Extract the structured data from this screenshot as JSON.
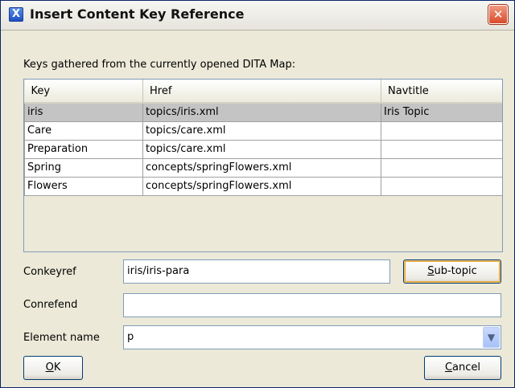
{
  "window": {
    "title": "Insert Content Key Reference",
    "close_glyph": "✕",
    "app_icon_glyph": "X"
  },
  "keys_label": "Keys gathered from the currently opened DITA Map:",
  "table": {
    "columns": [
      "Key",
      "Href",
      "Navtitle"
    ],
    "rows": [
      [
        "iris",
        "topics/iris.xml",
        "Iris Topic"
      ],
      [
        "Care",
        "topics/care.xml",
        ""
      ],
      [
        "Preparation",
        "topics/care.xml",
        ""
      ],
      [
        "Spring",
        "concepts/springFlowers.xml",
        ""
      ],
      [
        "Flowers",
        "concepts/springFlowers.xml",
        ""
      ]
    ],
    "selected_row": 0
  },
  "form": {
    "conkeyref_label": "Conkeyref",
    "conkeyref_value": "iris/iris-para",
    "subtopic_button": {
      "mnemonic": "S",
      "rest": "ub-topic"
    },
    "conrefend_label": "Conrefend",
    "conrefend_value": "",
    "element_name_label": "Element name",
    "element_name_value": "p",
    "dropdown_glyph": "▼"
  },
  "buttons": {
    "ok": {
      "mnemonic": "O",
      "rest": "K"
    },
    "cancel": {
      "mnemonic": "C",
      "rest": "ancel"
    }
  },
  "icons": [
    "app-icon",
    "close-icon",
    "chevron-down-icon"
  ]
}
